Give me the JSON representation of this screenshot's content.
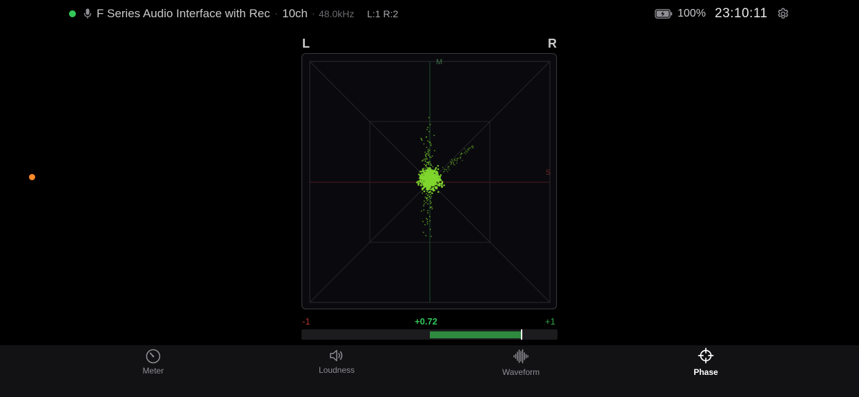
{
  "status": {
    "device_name": "F Series Audio Interface with Rec",
    "separator": "·",
    "channels": "10ch",
    "sample_rate": "48.0kHz",
    "lr_assign": "L:1 R:2",
    "battery": "100%",
    "time": "23:10:11",
    "connection_color": "#34c759",
    "record_color": "#ff8a2b"
  },
  "scope": {
    "left_label": "L",
    "right_label": "R",
    "mid_label": "M",
    "side_label": "S",
    "trace_color": "#7fd62e"
  },
  "correlation": {
    "min_label": "-1",
    "max_label": "+1",
    "value_label": "+0.72",
    "value": 0.72
  },
  "tabs": [
    {
      "label": "Meter",
      "icon": "meter-icon",
      "active": false
    },
    {
      "label": "Loudness",
      "icon": "speaker-icon",
      "active": false
    },
    {
      "label": "Waveform",
      "icon": "waveform-icon",
      "active": false
    },
    {
      "label": "Phase",
      "icon": "crosshair-icon",
      "active": true
    }
  ]
}
